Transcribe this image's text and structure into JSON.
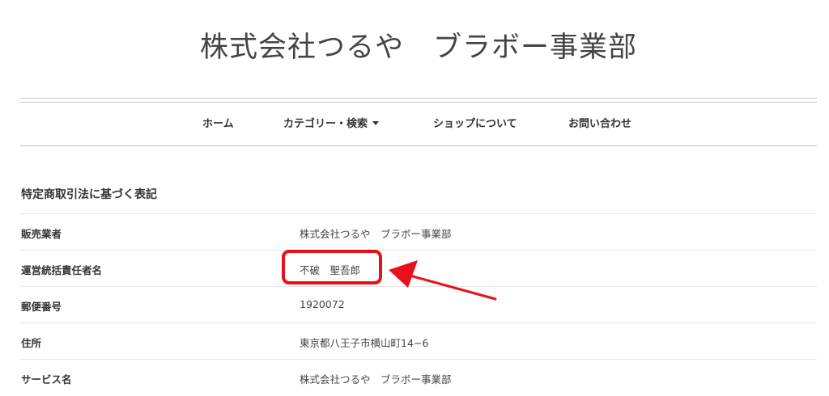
{
  "site": {
    "title": "株式会社つるや　ブラボー事業部"
  },
  "nav": {
    "home": "ホーム",
    "category": "カテゴリー・検索",
    "shop": "ショップについて",
    "contact": "お問い合わせ"
  },
  "section": {
    "title": "特定商取引法に基づく表記"
  },
  "rows": [
    {
      "label": "販売業者",
      "value": "株式会社つるや　ブラボー事業部"
    },
    {
      "label": "運営統括責任者名",
      "value": "不破　聖吾郎"
    },
    {
      "label": "郵便番号",
      "value": "1920072"
    },
    {
      "label": "住所",
      "value": "東京都八王子市横山町14−6"
    },
    {
      "label": "サービス名",
      "value": "株式会社つるや　ブラボー事業部"
    }
  ],
  "annotation": {
    "color": "#e8101b",
    "highlighted_row": "運営統括責任者名"
  },
  "colors": {
    "text": "#333333",
    "rule": "#c8c8c8",
    "accent": "#e8101b"
  }
}
